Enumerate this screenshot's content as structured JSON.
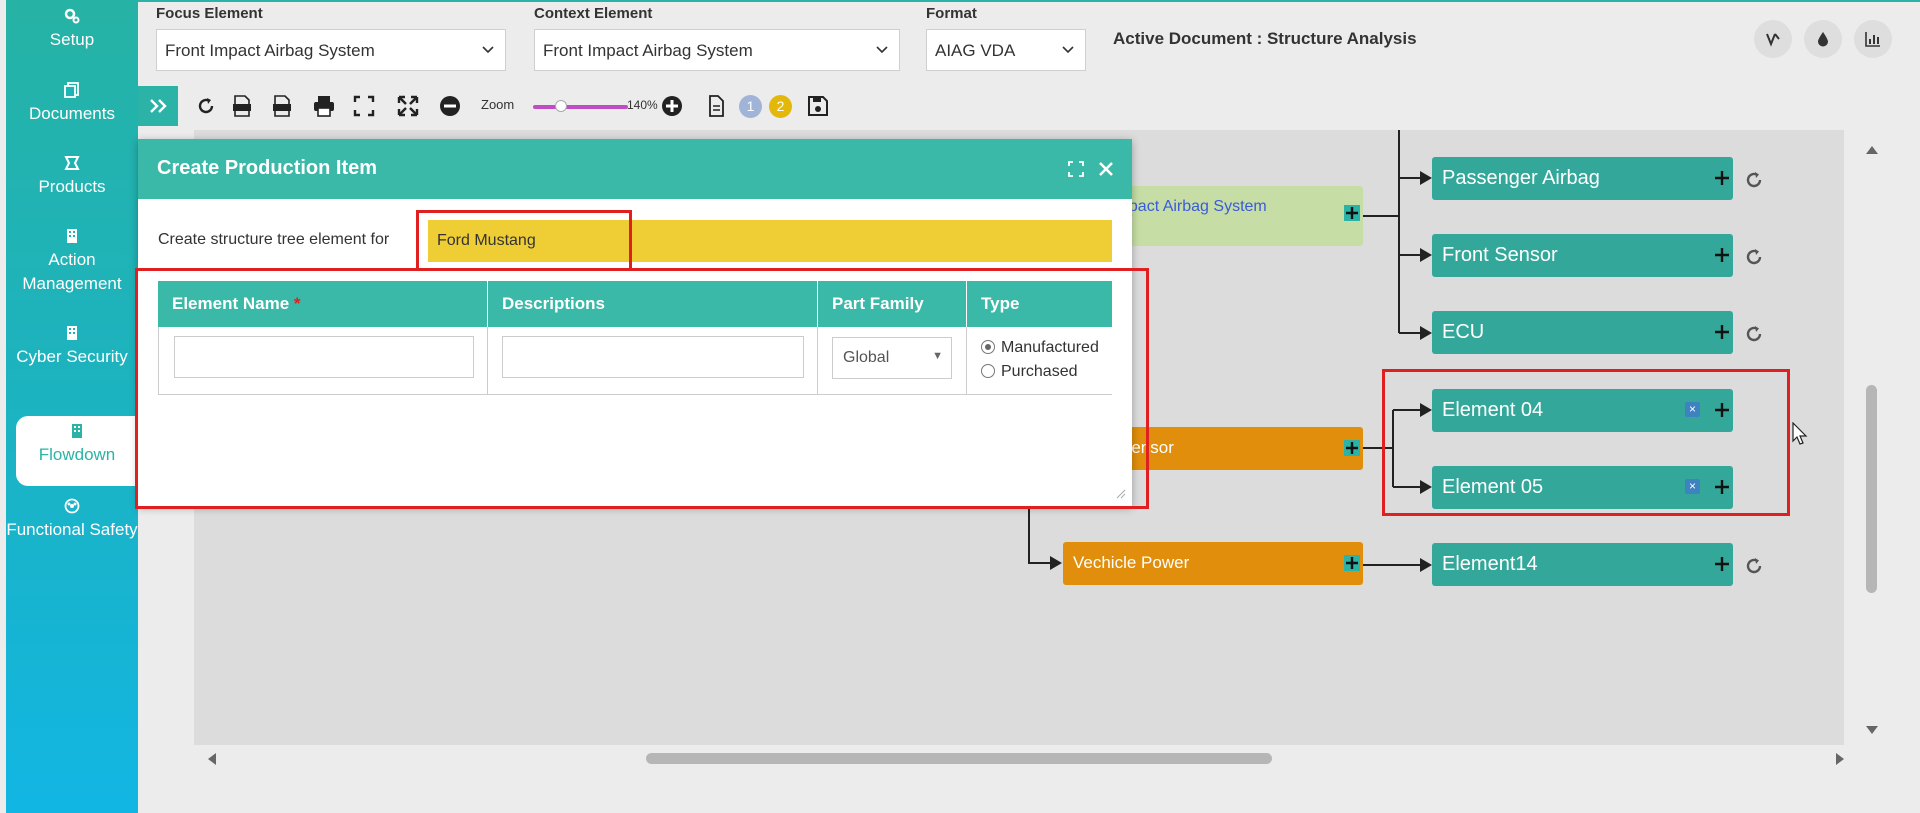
{
  "sidebar": {
    "items": [
      {
        "label": "Setup",
        "icon": "gears-icon"
      },
      {
        "label": "Documents",
        "icon": "documents-icon"
      },
      {
        "label": "Products",
        "icon": "products-icon"
      },
      {
        "label": "Action Management",
        "icon": "building-icon"
      },
      {
        "label": "Cyber Security",
        "icon": "building-icon"
      },
      {
        "label": "Flowdown",
        "icon": "building-icon",
        "active": true
      },
      {
        "label": "Functional Safety",
        "icon": "biohazard-icon"
      }
    ]
  },
  "header": {
    "focus_label": "Focus Element",
    "focus_value": "Front Impact Airbag System",
    "context_label": "Context Element",
    "context_value": "Front Impact Airbag System",
    "format_label": "Format",
    "format_value": "AIAG VDA",
    "active_document": "Active Document : Structure Analysis"
  },
  "toolbar": {
    "zoom_label": "Zoom",
    "zoom_value": "140%",
    "badge_1": "1",
    "badge_2": "2"
  },
  "tree": {
    "root_label": "npact Airbag System",
    "sensor_label": "Sensor",
    "power_label": "Vechicle Power",
    "children_top": [
      "Passenger Airbag",
      "Front Sensor",
      "ECU"
    ],
    "children_mid": [
      "Element 04",
      "Element 05"
    ],
    "children_bottom": [
      "Element14"
    ]
  },
  "modal": {
    "title": "Create Production Item",
    "for_label": "Create structure tree element for",
    "for_value": "Ford Mustang",
    "columns": {
      "name": "Element Name",
      "required": "*",
      "descriptions": "Descriptions",
      "part_family": "Part Family",
      "type": "Type"
    },
    "part_family_value": "Global",
    "type_options": [
      "Manufactured",
      "Purchased"
    ],
    "element_name_value": "",
    "description_value": ""
  },
  "colors": {
    "teal": "#33a89a",
    "orange": "#e08e0b",
    "yellow": "#efcd35",
    "lime": "#c6dea6",
    "annotation": "#e02020"
  }
}
